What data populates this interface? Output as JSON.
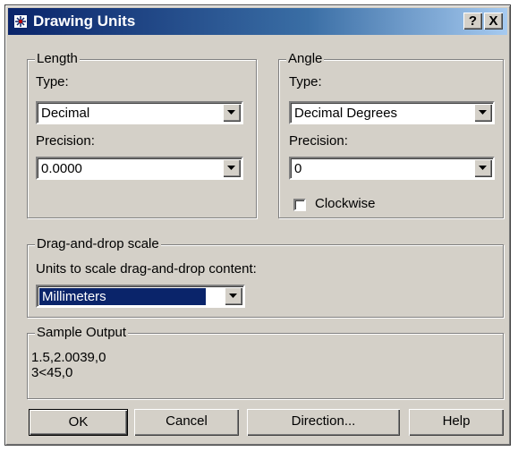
{
  "window": {
    "title": "Drawing Units",
    "icon": "drawing-units-app-icon",
    "help_label": "?",
    "close_label": "X"
  },
  "length": {
    "group_label": "Length",
    "type_label": "Type:",
    "type_value": "Decimal",
    "precision_label": "Precision:",
    "precision_value": "0.0000"
  },
  "angle": {
    "group_label": "Angle",
    "type_label": "Type:",
    "type_value": "Decimal Degrees",
    "precision_label": "Precision:",
    "precision_value": "0",
    "clockwise_label": "Clockwise",
    "clockwise_checked": false
  },
  "dragdrop": {
    "group_label": "Drag-and-drop scale",
    "units_label": "Units to scale drag-and-drop content:",
    "units_value": "Millimeters"
  },
  "sample": {
    "group_label": "Sample Output",
    "line1": "1.5,2.0039,0",
    "line2": "3<45,0"
  },
  "buttons": {
    "ok": "OK",
    "cancel": "Cancel",
    "direction": "Direction...",
    "help": "Help"
  },
  "colors": {
    "title_start": "#0a246a",
    "title_end": "#a6caf0",
    "face": "#d4d0c8",
    "selection": "#0a246a"
  }
}
